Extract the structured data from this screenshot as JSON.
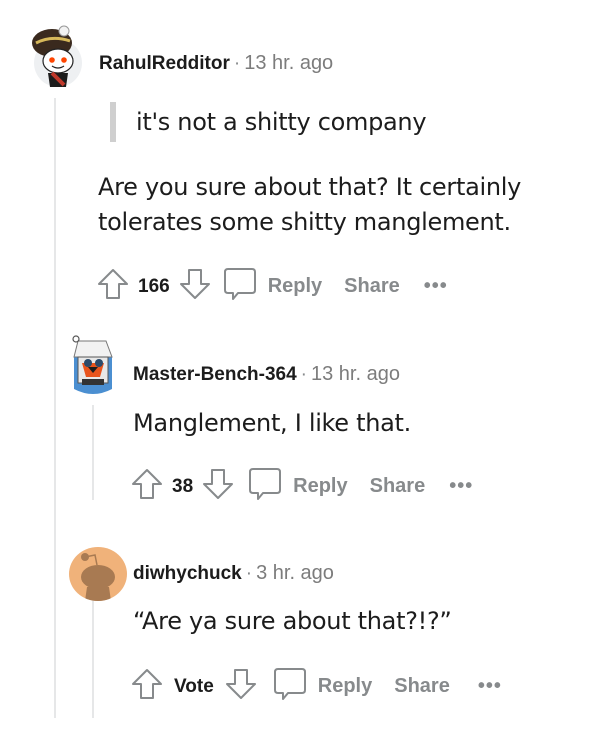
{
  "comments": [
    {
      "author": "RahulRedditor",
      "separator": "·",
      "time": "13 hr. ago",
      "quote": "it's not a shitty company",
      "body_lines": [
        "Are you sure about that? It certainly",
        "tolerates some shitty manglement."
      ],
      "score": "166",
      "reply_label": "Reply",
      "share_label": "Share",
      "more_label": "•••",
      "avatar_icon": "snoo-avatar-icon"
    },
    {
      "author": "Master-Bench-364",
      "separator": "·",
      "time": "13 hr. ago",
      "body": "Manglement, I like that.",
      "score": "38",
      "reply_label": "Reply",
      "share_label": "Share",
      "more_label": "•••",
      "avatar_icon": "robot-avatar-icon"
    },
    {
      "author": "diwhychuck",
      "separator": "·",
      "time": "3 hr. ago",
      "body": "“Are ya sure about that?!?”",
      "score": "Vote",
      "reply_label": "Reply",
      "share_label": "Share",
      "more_label": "•••",
      "avatar_icon": "default-snoo-avatar-icon"
    }
  ],
  "colors": {
    "text": "#1c1c1c",
    "meta": "#7c7c7c",
    "action": "#878a8c",
    "thread_line": "#e6e7e8",
    "default_avatar_bg": "#f0b27a"
  }
}
